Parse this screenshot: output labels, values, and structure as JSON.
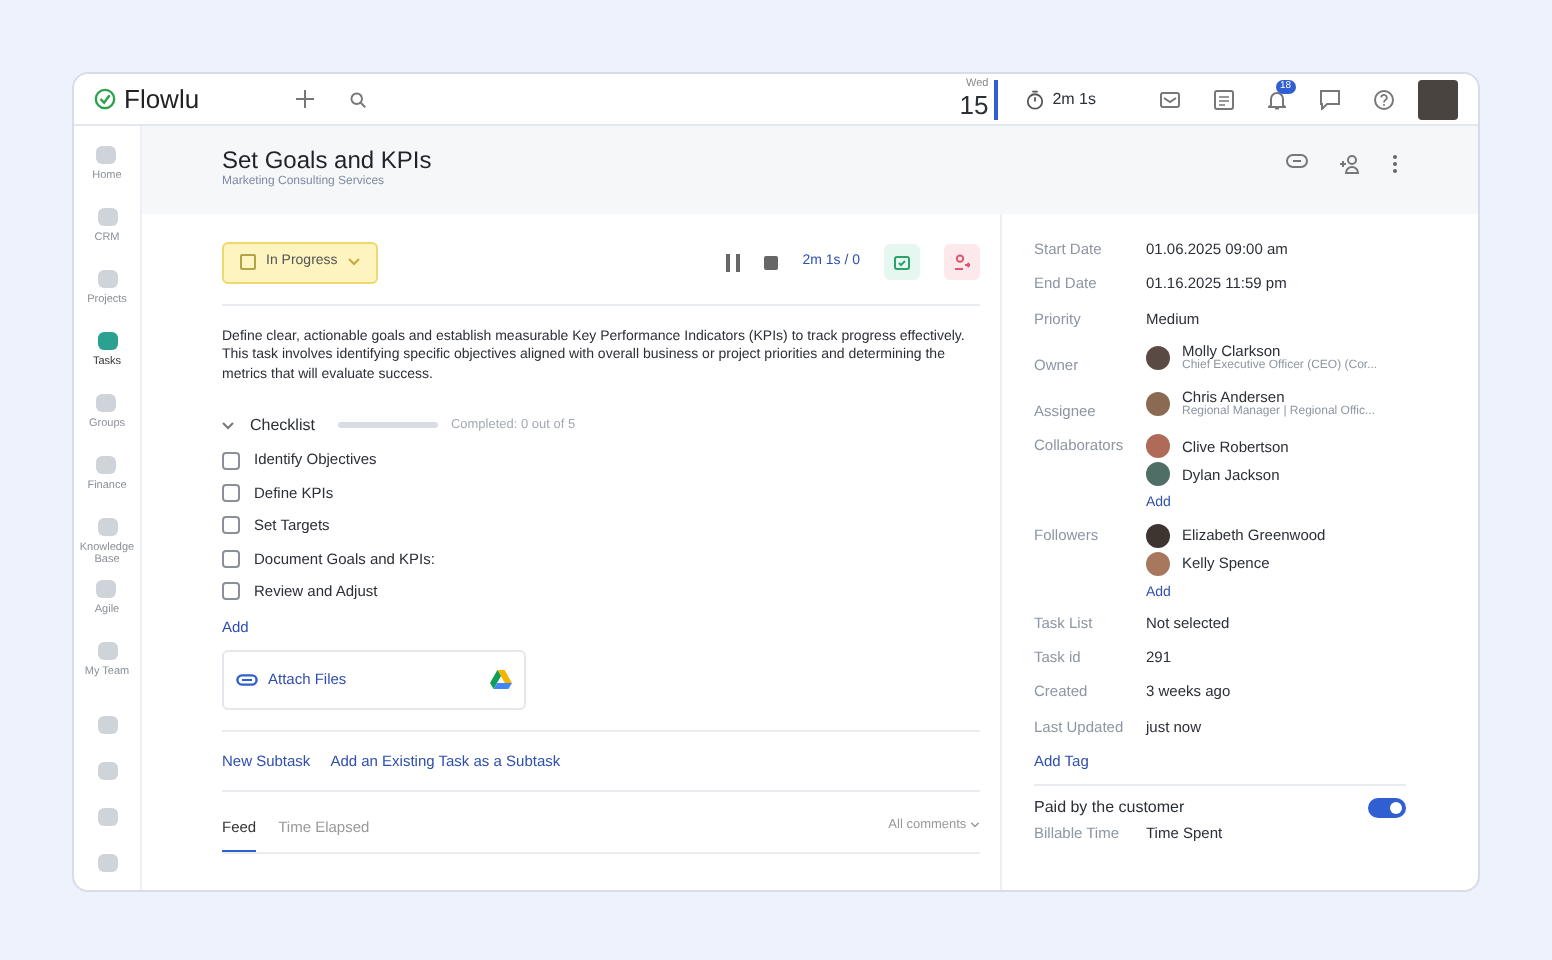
{
  "topbar": {
    "logo": "Flowlu",
    "weekday": "Wed",
    "day": "15",
    "timer": "2m 1s",
    "notification_count": "18"
  },
  "sidebar": {
    "items": [
      {
        "label": "Home",
        "selected": false
      },
      {
        "label": "CRM",
        "selected": false
      },
      {
        "label": "Projects",
        "selected": false
      },
      {
        "label": "Tasks",
        "selected": true
      },
      {
        "label": "Groups",
        "selected": false
      },
      {
        "label": "Finance",
        "selected": false
      },
      {
        "label": "Knowledge Base",
        "selected": false
      },
      {
        "label": "Agile",
        "selected": false
      },
      {
        "label": "My Team",
        "selected": false
      }
    ]
  },
  "task": {
    "title": "Set Goals and KPIs",
    "project": "Marketing Consulting Services",
    "status": "In Progress",
    "time": "2m 1s / 0",
    "description": "Define clear, actionable goals and establish measurable Key Performance Indicators (KPIs) to track progress effectively. This task involves identifying specific objectives aligned with overall business or project priorities and determining the metrics that will evaluate success.",
    "checklist": {
      "title": "Checklist",
      "expanded": true,
      "level": 0,
      "summary": "Completed: 0 out of 5",
      "add": "Add",
      "items": [
        {
          "label": "Identify Objectives",
          "checked": false
        },
        {
          "label": "Define KPIs",
          "checked": false
        },
        {
          "label": "Set Targets",
          "checked": false
        },
        {
          "label": "Document Goals and KPIs:",
          "checked": false
        },
        {
          "label": "Review and Adjust",
          "checked": false
        }
      ]
    },
    "attach": "Attach Files",
    "subtask_links": [
      "New Subtask",
      "Add an Existing Task as a Subtask"
    ],
    "feed_tabs": [
      {
        "label": "Feed",
        "selected": true
      },
      {
        "label": "Time Elapsed",
        "selected": false
      }
    ],
    "comments_filter": "All comments"
  },
  "details": {
    "fields": [
      {
        "kind": "text",
        "label": "Start Date",
        "value": "01.06.2025 09:00 am"
      },
      {
        "kind": "text",
        "label": "End Date",
        "value": "01.16.2025 11:59 pm"
      },
      {
        "kind": "text",
        "label": "Priority",
        "value": "Medium"
      },
      {
        "kind": "people",
        "label": "Owner",
        "people": [
          {
            "name": "Molly Clarkson",
            "role": "Chief Executive Officer (CEO) (Cor...",
            "color": "#5a4a44"
          }
        ]
      },
      {
        "kind": "people",
        "label": "Assignee",
        "people": [
          {
            "name": "Chris Andersen",
            "role": "Regional Manager | Regional Offic...",
            "color": "#8a6a52"
          }
        ]
      },
      {
        "kind": "people",
        "label": "Collaborators",
        "people": [
          {
            "name": "Clive Robertson",
            "color": "#b06a58"
          },
          {
            "name": "Dylan Jackson",
            "color": "#4f6e66"
          }
        ],
        "add": "Add"
      },
      {
        "kind": "people",
        "label": "Followers",
        "people": [
          {
            "name": "Elizabeth Greenwood",
            "color": "#3e3430"
          },
          {
            "name": "Kelly Spence",
            "color": "#a8785e"
          }
        ],
        "add": "Add"
      },
      {
        "kind": "text",
        "label": "Task List",
        "value": "Not selected"
      },
      {
        "kind": "text",
        "label": "Task id",
        "value": "291"
      },
      {
        "kind": "text",
        "label": "Created",
        "value": "3 weeks ago"
      },
      {
        "kind": "text",
        "label": "Last Updated",
        "value": "just now"
      }
    ],
    "add_tag": "Add Tag",
    "paid": {
      "label": "Paid by the customer",
      "on": true
    },
    "billable": {
      "label": "Billable Time",
      "value": "Time Spent"
    }
  }
}
